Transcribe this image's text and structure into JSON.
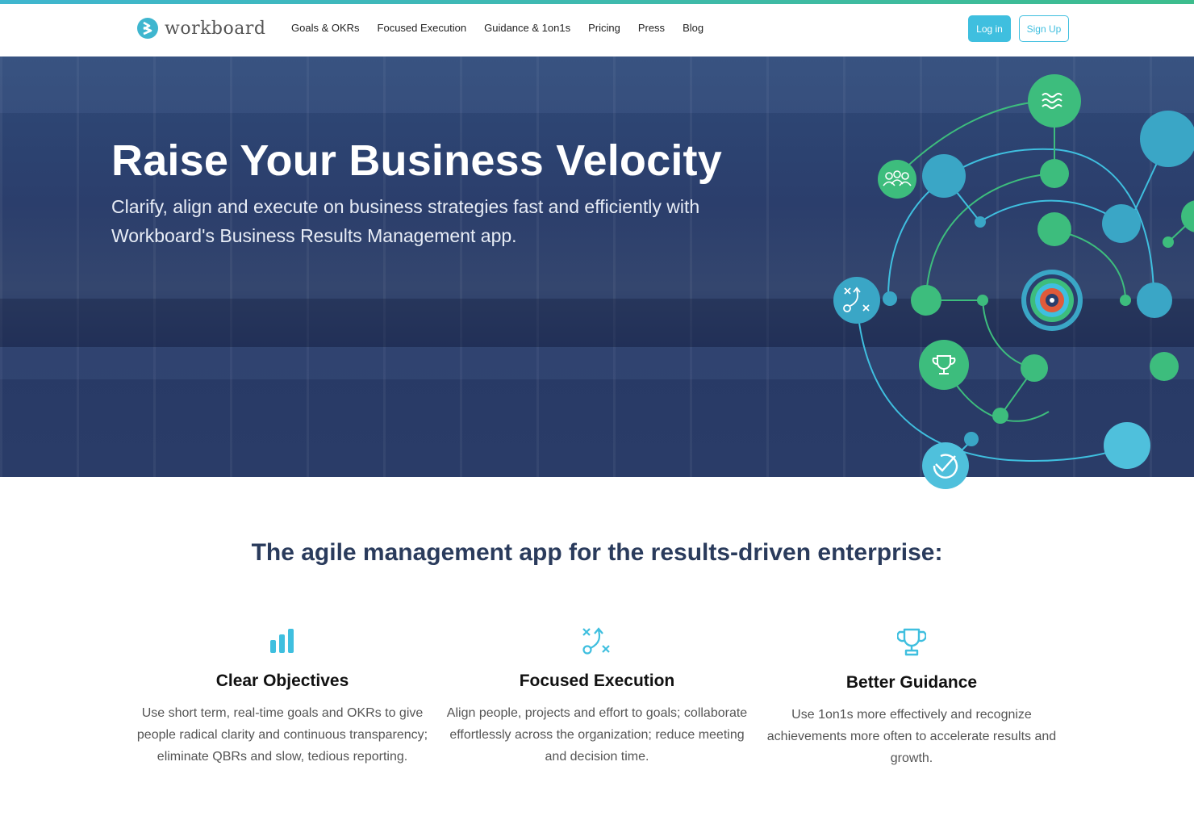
{
  "header": {
    "logo_text": "workboard",
    "nav": [
      "Goals & OKRs",
      "Focused Execution",
      "Guidance & 1on1s",
      "Pricing",
      "Press",
      "Blog"
    ],
    "login_label": "Log in",
    "signup_label": "Sign Up"
  },
  "hero": {
    "title": "Raise Your Business Velocity",
    "subtitle": "Clarify, align and execute on business strategies fast and efficiently with Workboard's Business Results Management app."
  },
  "tagline": "The agile management app for the results-driven enterprise:",
  "features": [
    {
      "icon": "bar-chart-icon",
      "title": "Clear Objectives",
      "text": "Use short term, real-time goals and OKRs to give people radical clarity and continuous transparency; eliminate QBRs and slow, tedious reporting."
    },
    {
      "icon": "strategy-play-icon",
      "title": "Focused Execution",
      "text": "Align people, projects and effort to goals; collaborate effortlessly across the organization; reduce meeting and decision time."
    },
    {
      "icon": "trophy-icon",
      "title": "Better Guidance",
      "text": "Use 1on1s more effectively and recognize achievements more often to accelerate results and growth."
    }
  ],
  "colors": {
    "accent_blue": "#3fbfdf",
    "accent_green": "#3dbd7d",
    "hero_bg": "#2b3e6c",
    "tagline": "#2a3b5c"
  }
}
